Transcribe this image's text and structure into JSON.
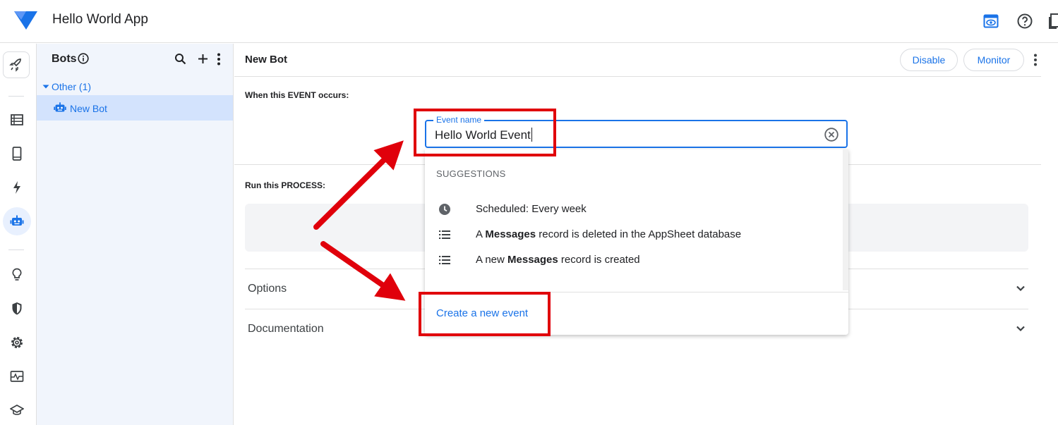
{
  "app": {
    "title": "Hello World App"
  },
  "bots_panel": {
    "title": "Bots",
    "group_label": "Other (1)",
    "items": [
      {
        "label": "New Bot",
        "selected": true
      }
    ]
  },
  "editor": {
    "bot_name": "New Bot",
    "disable_label": "Disable",
    "monitor_label": "Monitor",
    "event_section_label": "When this EVENT occurs:",
    "process_section_label": "Run this PROCESS:",
    "event_field": {
      "legend": "Event name",
      "value": "Hello World Event"
    },
    "accordions": [
      {
        "label": "Options"
      },
      {
        "label": "Documentation"
      }
    ]
  },
  "dropdown": {
    "header": "SUGGESTIONS",
    "suggestions": [
      {
        "icon": "clock-icon",
        "parts": [
          "Scheduled: Every week"
        ]
      },
      {
        "icon": "list-icon",
        "parts": [
          "A ",
          "Messages",
          " record is deleted in the AppSheet database"
        ]
      },
      {
        "icon": "list-icon",
        "parts": [
          "A new ",
          "Messages",
          " record is created"
        ]
      }
    ],
    "create_label": "Create a new event"
  },
  "colors": {
    "accent": "#1a73e8",
    "selected_bg": "#d3e3fd",
    "panel_bg": "#f1f5fc",
    "annotation_red": "#e0000b"
  }
}
